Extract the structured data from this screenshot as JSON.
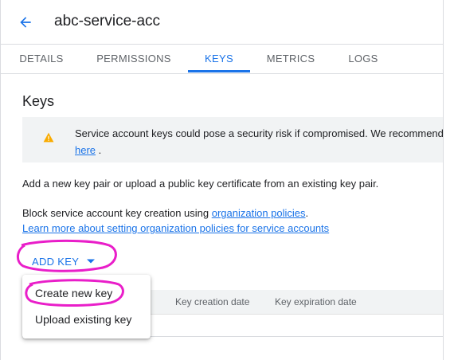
{
  "header": {
    "title": "abc-service-acc",
    "back_icon": "arrow-back-icon"
  },
  "tabs": [
    {
      "label": "DETAILS"
    },
    {
      "label": "PERMISSIONS"
    },
    {
      "label": "KEYS",
      "active": true
    },
    {
      "label": "METRICS"
    },
    {
      "label": "LOGS"
    }
  ],
  "keys": {
    "title": "Keys",
    "warning": {
      "icon": "warning-icon",
      "text": "Service account keys could pose a security risk if compromised. We recommend",
      "link": "here",
      "suffix": " ."
    },
    "description": "Add a new key pair or upload a public key certificate from an existing key pair.",
    "block_text": "Block service account key creation using ",
    "block_link": "organization policies",
    "block_suffix": ".",
    "learn_more_link": "Learn more about setting organization policies for service accounts",
    "add_key_label": "ADD KEY",
    "add_key_icon": "arrow-drop-down-icon"
  },
  "table": {
    "columns": [
      "Key creation date",
      "Key expiration date"
    ]
  },
  "menu": {
    "items": [
      "Create new key",
      "Upload existing key"
    ]
  },
  "colors": {
    "accent": "#1a73e8",
    "highlight": "#e91ec9",
    "warning": "#f9ab00"
  }
}
